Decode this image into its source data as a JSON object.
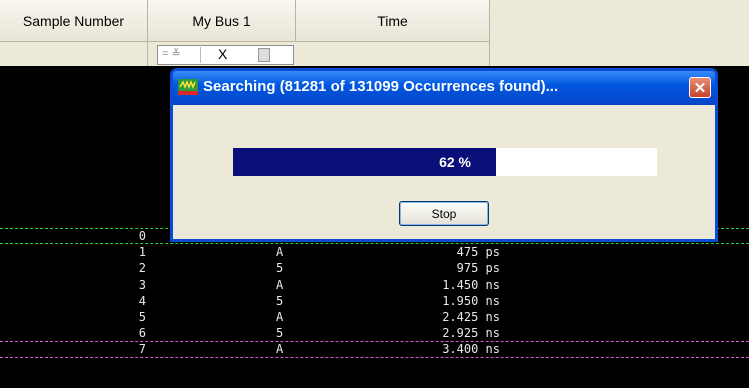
{
  "columns": {
    "sample_number": "Sample Number",
    "bus": "My Bus 1",
    "time": "Time"
  },
  "filter": {
    "operator": "= ≚",
    "value": "X"
  },
  "rows": [
    {
      "num": "0",
      "bus": "",
      "time": ""
    },
    {
      "num": "1",
      "bus": "A",
      "time": "475 ps"
    },
    {
      "num": "2",
      "bus": "5",
      "time": "975 ps"
    },
    {
      "num": "3",
      "bus": "A",
      "time": "1.450 ns"
    },
    {
      "num": "4",
      "bus": "5",
      "time": "1.950 ns"
    },
    {
      "num": "5",
      "bus": "A",
      "time": "2.425 ns"
    },
    {
      "num": "6",
      "bus": "5",
      "time": "2.925 ns"
    },
    {
      "num": "7",
      "bus": "A",
      "time": "3.400 ns"
    }
  ],
  "dialog": {
    "title": "Searching (81281 of 131099 Occurrences found)...",
    "progress_label": "62 %",
    "progress_fraction": 0.62,
    "stop_label": "Stop",
    "close_icon": "close-icon"
  },
  "colors": {
    "progress_fill": "#0a0e78",
    "titlebar": "#0258e0",
    "marker_green": "#29d13b",
    "marker_pink": "#d45bd0"
  }
}
